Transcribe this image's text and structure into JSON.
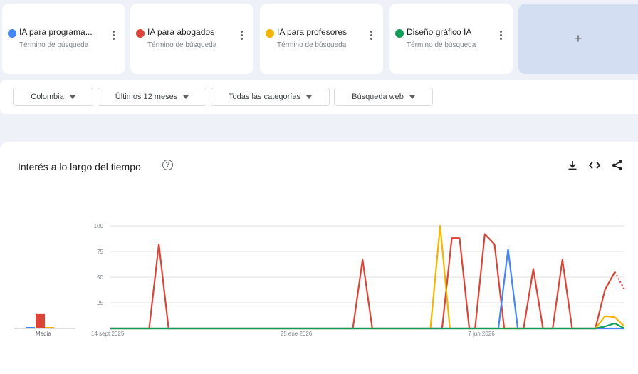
{
  "terms": [
    {
      "name": "IA para programa...",
      "sub": "Término de búsqueda",
      "color": "#4285f4",
      "x": 0
    },
    {
      "name": "IA para abogados",
      "sub": "Término de búsqueda",
      "color": "#db4437",
      "x": 180
    },
    {
      "name": "IA para profesores",
      "sub": "Término de búsqueda",
      "color": "#f4b400",
      "x": 362
    },
    {
      "name": "Diseño gráfico IA",
      "sub": "Término de búsqueda",
      "color": "#0f9d58",
      "x": 544
    }
  ],
  "add_label": "+",
  "filters": {
    "region": "Colombia",
    "period": "Últimos 12 meses",
    "category": "Todas las categorías",
    "search_type": "Búsqueda web"
  },
  "panel": {
    "title": "Interés a lo largo del tiempo",
    "help": "?",
    "average_label": "Media"
  },
  "chart_data": {
    "type": "line",
    "y_ticks": [
      100,
      75,
      50,
      25
    ],
    "ylim": [
      0,
      100
    ],
    "x_labels": [
      "14 sept 2025",
      "25 ene 2026",
      "7 jun 2026"
    ],
    "averages": {
      "IA para programa...": 1,
      "IA para abogados": 14,
      "IA para profesores": 1,
      "Diseño gráfico IA": 0
    },
    "series": [
      {
        "name": "IA para abogados",
        "color": "#db4437",
        "points": [
          [
            0,
            0
          ],
          [
            20,
            0
          ],
          [
            25,
            82
          ],
          [
            30,
            0
          ],
          [
            125,
            0
          ],
          [
            130,
            67
          ],
          [
            135,
            0
          ],
          [
            171,
            0
          ],
          [
            176,
            88
          ],
          [
            180,
            88
          ],
          [
            185,
            0
          ],
          [
            188,
            0
          ],
          [
            193,
            92
          ],
          [
            198,
            82
          ],
          [
            203,
            0
          ],
          [
            213,
            0
          ],
          [
            218,
            58
          ],
          [
            223,
            0
          ],
          [
            228,
            0
          ],
          [
            233,
            67
          ],
          [
            238,
            0
          ],
          [
            250,
            0
          ],
          [
            255,
            38
          ],
          [
            260,
            55
          ]
        ],
        "dotted_tail": [
          [
            260,
            55
          ],
          [
            265,
            38
          ]
        ]
      },
      {
        "name": "IA para profesores",
        "color": "#f4b400",
        "points": [
          [
            0,
            0
          ],
          [
            165,
            0
          ],
          [
            170,
            100
          ],
          [
            175,
            0
          ],
          [
            250,
            0
          ],
          [
            255,
            12
          ],
          [
            260,
            11
          ],
          [
            265,
            2
          ]
        ]
      },
      {
        "name": "IA para programa...",
        "color": "#4285f4",
        "points": [
          [
            0,
            0
          ],
          [
            200,
            0
          ],
          [
            205,
            77
          ],
          [
            210,
            0
          ],
          [
            265,
            0
          ]
        ]
      },
      {
        "name": "Diseño gráfico IA",
        "color": "#0f9d58",
        "points": [
          [
            0,
            0
          ],
          [
            250,
            0
          ],
          [
            255,
            2
          ],
          [
            260,
            5
          ],
          [
            265,
            0
          ]
        ]
      }
    ]
  }
}
